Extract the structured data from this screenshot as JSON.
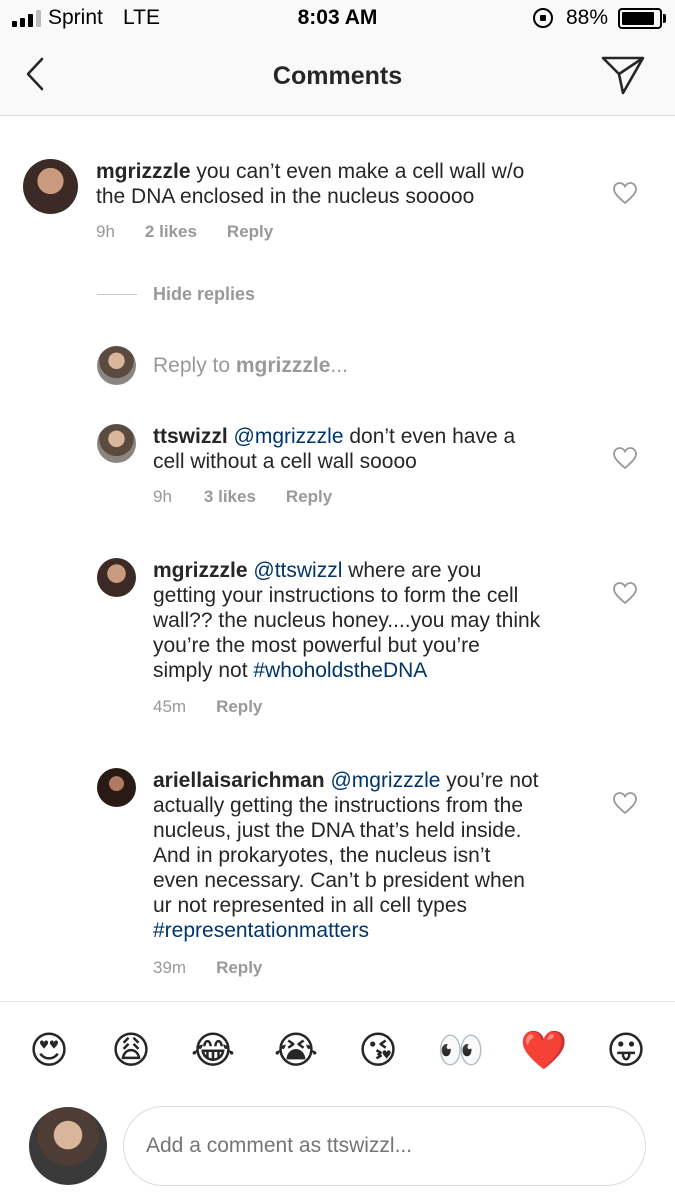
{
  "status_bar": {
    "carrier": "Sprint",
    "network": "LTE",
    "time": "8:03 AM",
    "battery_percent": "88%",
    "battery_level": 0.88
  },
  "header": {
    "title": "Comments",
    "back_icon": "chevron-left-icon",
    "send_icon": "paper-plane-icon"
  },
  "comments": [
    {
      "username": "mgrizzzle",
      "text_line1": " you can’t even make a cell wall w/o",
      "text_line2": "the DNA enclosed in the nucleus sooooo",
      "time": "9h",
      "likes": "2 likes",
      "reply": "Reply"
    },
    {
      "username": "ttswizzl",
      "mention": "@mgrizzzle",
      "text_line1": " don’t even have a",
      "text_line2": "cell without a cell wall soooo",
      "time": "9h",
      "likes": "3 likes",
      "reply": "Reply"
    },
    {
      "username": "mgrizzzle",
      "mention": "@ttswizzl",
      "text_line1": " where are you",
      "text_line2": "getting your instructions to form the cell",
      "text_line3": "wall?? the nucleus honey....you may think",
      "text_line4": "you’re the most powerful but you’re",
      "text_line5_prefix": "simply not ",
      "hashtag": "#whoholdstheDNA",
      "time": "45m",
      "reply": "Reply"
    },
    {
      "username": "ariellaisarichman",
      "mention": "@mgrizzzle",
      "text_line1": " you’re not",
      "text_line2": "actually getting the instructions from the",
      "text_line3": "nucleus, just the DNA that’s held inside.",
      "text_line4": "And in prokaryotes, the nucleus isn’t",
      "text_line5": "even necessary. Can’t b president when",
      "text_line6": "ur not represented in all cell types",
      "hashtag": "#representationmatters",
      "time": "39m",
      "reply": "Reply"
    }
  ],
  "hide_replies": "Hide replies",
  "reply_to": {
    "prefix": "Reply to ",
    "username": "mgrizzzle",
    "suffix": "..."
  },
  "emoji_bar": [
    "😍",
    "😩",
    "😂",
    "😭",
    "😘",
    "👀",
    "❤️",
    "😛"
  ],
  "comment_input": {
    "placeholder": "Add a comment as ttswizzl..."
  },
  "colors": {
    "mention": "#003569",
    "muted": "#999999",
    "text": "#262626"
  }
}
